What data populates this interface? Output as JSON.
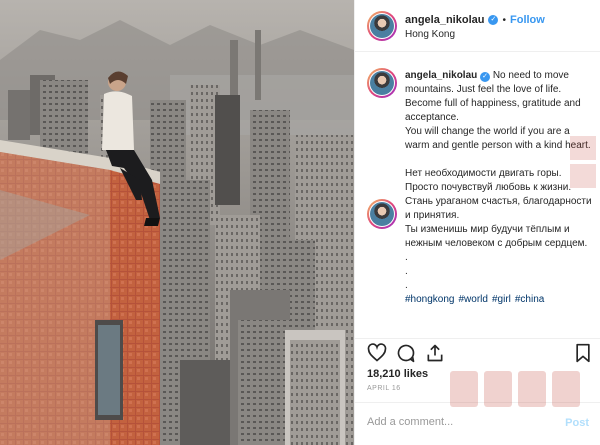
{
  "header": {
    "username": "angela_nikolau",
    "follow_label": "Follow",
    "separator": "•",
    "location": "Hong Kong"
  },
  "caption": {
    "username": "angela_nikolau",
    "en_lines": [
      "No need to move mountains. Just feel the love of life. Become full of happiness, gratitude and acceptance.",
      "You will change the world if you are a warm and gentle person with a kind heart."
    ],
    "ru_lines": [
      "Нет необходимости двигать горы. Просто почувствуй любовь к жизни. Стань ураганом счастья, благодарности и принятия.",
      "Ты изменишь мир будучи тёплым и нежным человеком с добрым сердцем."
    ],
    "dots": [
      ".",
      ".",
      "."
    ],
    "hashtags": [
      "#hongkong",
      "#world",
      "#girl",
      "#china"
    ]
  },
  "actions": {
    "like_icon": "heart-icon",
    "comment_icon": "comment-icon",
    "share_icon": "share-icon",
    "save_icon": "bookmark-icon"
  },
  "likes": "18,210 likes",
  "date": "APRIL 16",
  "comment_box": {
    "placeholder": "Add a comment...",
    "post_label": "Post"
  },
  "colors": {
    "link_blue": "#3897f0",
    "post_disabled": "#b2dffc",
    "hashtag": "#003569",
    "border": "#efefef"
  }
}
